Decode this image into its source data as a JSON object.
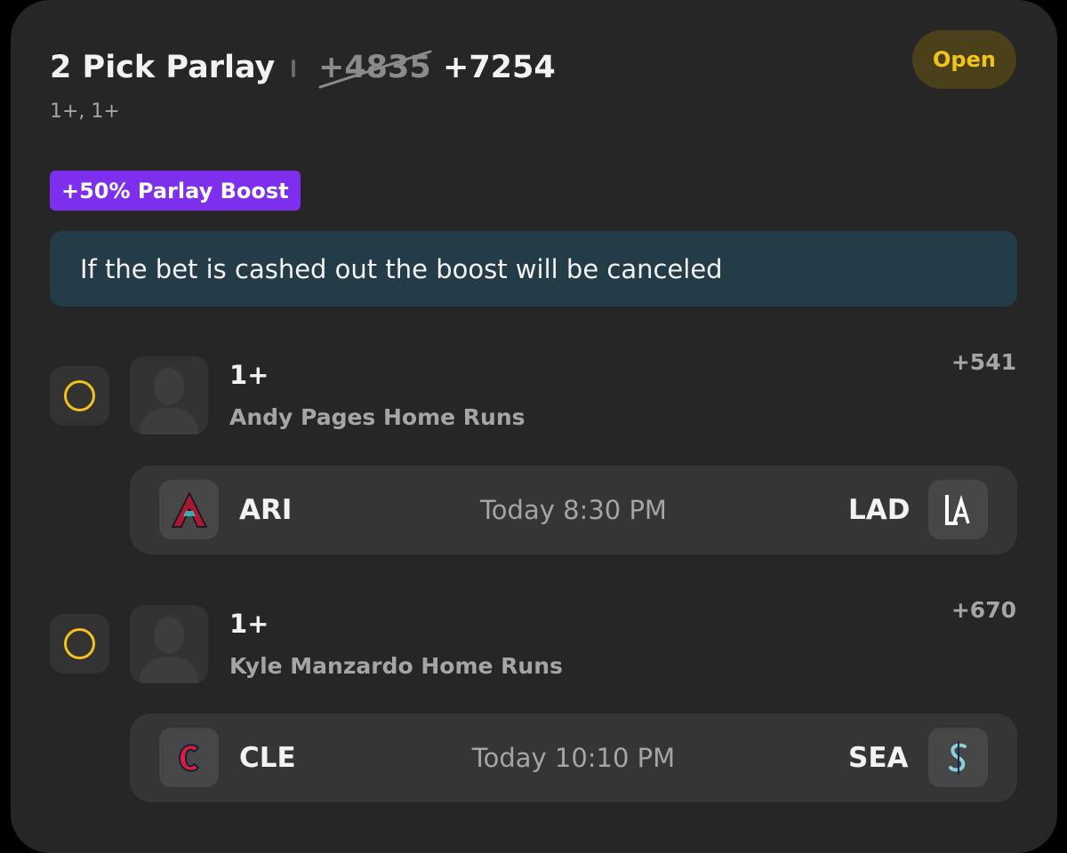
{
  "header": {
    "title": "2 Pick Parlay",
    "original_odds": "+4835",
    "boosted_odds": "+7254",
    "subtitle": "1+, 1+",
    "status": "Open"
  },
  "boost_badge": "+50% Parlay Boost",
  "notice": "If the bet is cashed out the boost will be canceled",
  "picks": [
    {
      "line": "1+",
      "market": "Andy Pages Home Runs",
      "odds": "+541",
      "game": {
        "away_team": "ARI",
        "away_logo": "diamondbacks-logo",
        "time": "Today 8:30 PM",
        "home_team": "LAD",
        "home_logo": "dodgers-logo"
      }
    },
    {
      "line": "1+",
      "market": "Kyle Manzardo Home Runs",
      "odds": "+670",
      "game": {
        "away_team": "CLE",
        "away_logo": "guardians-logo",
        "time": "Today 10:10 PM",
        "home_team": "SEA",
        "home_logo": "mariners-logo"
      }
    }
  ],
  "colors": {
    "accent_yellow": "#f4c31a",
    "boost_purple": "#7e2fee",
    "notice_bg": "#243b48",
    "card_bg": "#262626"
  }
}
